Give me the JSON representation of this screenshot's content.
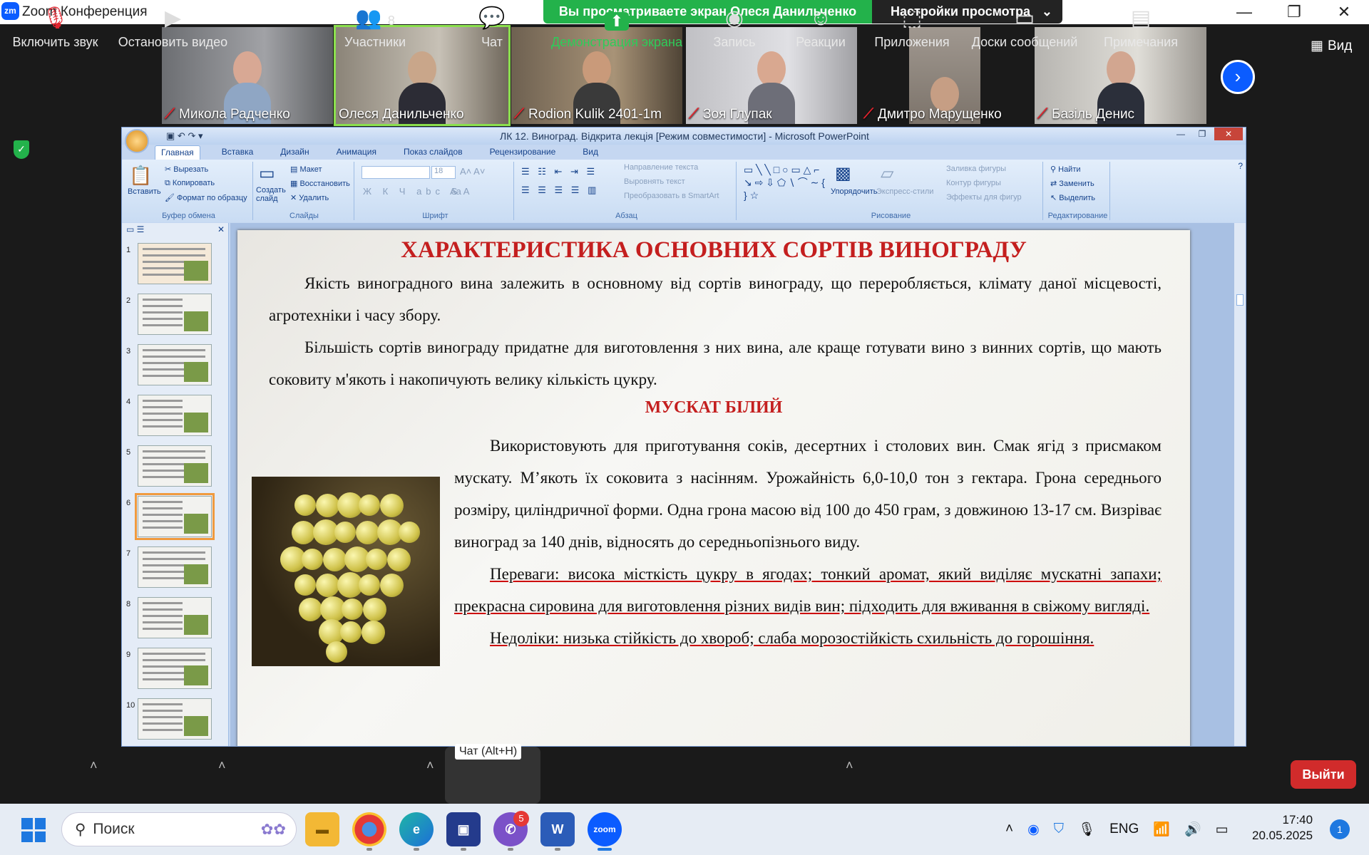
{
  "zoom": {
    "title": "Zoom Конференция",
    "logo": "zm",
    "share_banner": "Вы просматриваете экран Олеся Данильченко",
    "view_settings": "Настройки просмотра",
    "view_label": "Вид"
  },
  "participants": [
    {
      "name": "Микола Радченко",
      "muted": true
    },
    {
      "name": "Олеся Данильченко",
      "muted": false,
      "active": true
    },
    {
      "name": "Rodion Kulik 2401-1m",
      "muted": true
    },
    {
      "name": "Зоя Глупак",
      "muted": true
    },
    {
      "name": "Дмитро Марущенко",
      "muted": true
    },
    {
      "name": "Базіль Денис",
      "muted": true
    }
  ],
  "powerpoint": {
    "title": "ЛК 12. Виноград. Відкрита лекція [Режим совместимости] - Microsoft PowerPoint",
    "tabs": [
      "Главная",
      "Вставка",
      "Дизайн",
      "Анимация",
      "Показ слайдов",
      "Рецензирование",
      "Вид"
    ],
    "groups": {
      "clipboard": "Буфер обмена",
      "slides": "Слайды",
      "font": "Шрифт",
      "paragraph": "Абзац",
      "drawing": "Рисование",
      "editing": "Редактирование"
    },
    "buttons": {
      "paste": "Вставить",
      "cut": "Вырезать",
      "copy": "Копировать",
      "format_painter": "Формат по образцу",
      "new_slide": "Создать слайд",
      "layout": "Макет",
      "reset": "Восстановить",
      "delete": "Удалить",
      "font_size": "18",
      "text_direction": "Направление текста",
      "align_text": "Выровнять текст",
      "smartart": "Преобразовать в SmartArt",
      "arrange": "Упорядочить",
      "quick_styles": "Экспресс-стили",
      "shape_fill": "Заливка фигуры",
      "shape_outline": "Контур фигуры",
      "shape_effects": "Эффекты для фигур",
      "find": "Найти",
      "replace": "Заменить",
      "select": "Выделить"
    },
    "slide_numbers": [
      "1",
      "2",
      "3",
      "4",
      "5",
      "6",
      "7",
      "8",
      "9",
      "10"
    ],
    "slide": {
      "title": "ХАРАКТЕРИСТИКА ОСНОВНИХ СОРТІВ ВИНОГРАДУ",
      "p1": "Якість виноградного вина залежить в основному від сортів винограду, що переробляється, клімату даної місцевості, агротехніки і часу збору.",
      "p2": "Більшість сортів винограду придатне для виготовлення з них вина, але краще готувати вино з винних сортів, що мають соковиту м'якоть і накопичують велику кількість цукру.",
      "subtitle": "МУСКАТ БІЛИЙ",
      "p3": "Використовують для приготування соків, десертних і столових вин. Смак ягід з присмаком мускату. М’якоть їх соковита з насінням. Урожайність 6,0-10,0 тон з гектара. Грона середнього розміру, циліндричної форми. Одна грона масою від 100 до 450 грам, з довжиною 13-17 см. Визріває виноград за 140 днів, відносять до середньопізнього виду.",
      "p4": "Переваги: висока місткість цукру в ягодах; тонкий аромат, який виділяє мускатні запахи; прекрасна сировина для виготовлення різних видів вин; підходить для вживання в свіжому вигляді.",
      "p5": "Недоліки: низька стійкість до хвороб; слаба морозостійкість  схильність до горошіння."
    }
  },
  "toolbar": {
    "audio": "Включить звук",
    "video": "Остановить видео",
    "participants": "Участники",
    "participants_count": "8",
    "chat": "Чат",
    "chat_tooltip": "Чат (Alt+H)",
    "share": "Демонстрация экрана",
    "record": "Запись",
    "reactions": "Реакции",
    "apps": "Приложения",
    "whiteboards": "Доски сообщений",
    "notes": "Примечания",
    "leave": "Выйти"
  },
  "taskbar": {
    "search": "Поиск",
    "viber_badge": "5",
    "language": "ENG",
    "time": "17:40",
    "date": "20.05.2025",
    "notifications": "1"
  },
  "colors": {
    "zoom_blue": "#0b5cff",
    "share_green": "#23b24b",
    "leave_red": "#d12b2b",
    "slide_title_red": "#c41f1f"
  }
}
